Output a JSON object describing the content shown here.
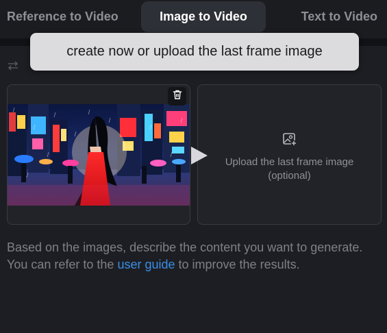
{
  "tabs": {
    "reference": "Reference to Video",
    "image": "Image to Video",
    "text": "Text to Video"
  },
  "tooltip": "create now or upload the last frame image",
  "icons": {
    "swap": "swap-arrows-icon",
    "delete": "trash-icon",
    "next": "play-arrow-icon",
    "upload": "image-add-icon"
  },
  "upload": {
    "line1": "Upload the last frame image",
    "line2": "(optional)"
  },
  "description": {
    "before": "Based on the images, describe the content you want to generate. You can refer to the ",
    "link": "user guide",
    "after": " to improve the results."
  },
  "colors": {
    "accent_link": "#3a8ee6",
    "active_tab": "#2e3037",
    "background": "#1d1e23"
  }
}
